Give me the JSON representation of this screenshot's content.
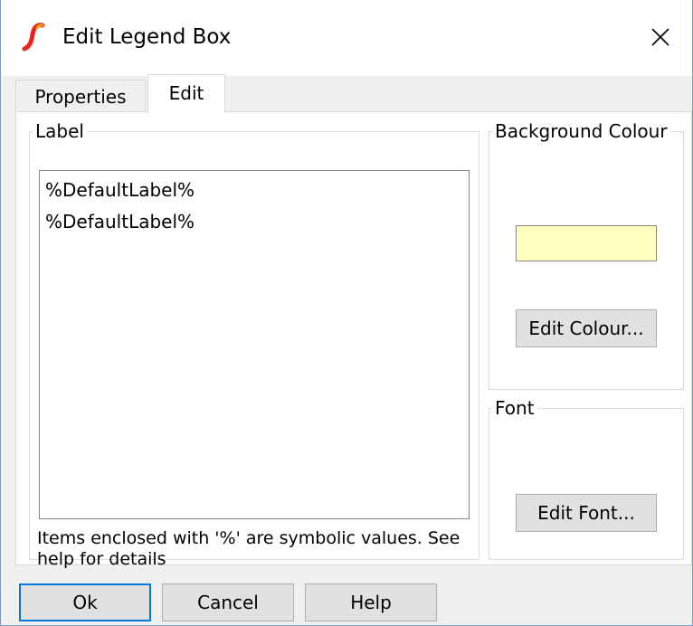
{
  "window": {
    "title": "Edit Legend Box",
    "icon": "simetrix-logo-icon",
    "close_icon": "close-icon",
    "accent_color": "#0078d7"
  },
  "tabs": [
    {
      "label": "Properties",
      "active": false
    },
    {
      "label": "Edit",
      "active": true
    }
  ],
  "label_group": {
    "title": "Label",
    "text": "%DefaultLabel%\n%DefaultLabel%",
    "hint": "Items enclosed with '%' are symbolic values. See help for details"
  },
  "background_group": {
    "title": "Background Colour",
    "swatch_color": "#ffffc0",
    "edit_button": "Edit Colour..."
  },
  "font_group": {
    "title": "Font",
    "edit_button": "Edit Font..."
  },
  "footer": {
    "ok": "Ok",
    "cancel": "Cancel",
    "help": "Help"
  }
}
